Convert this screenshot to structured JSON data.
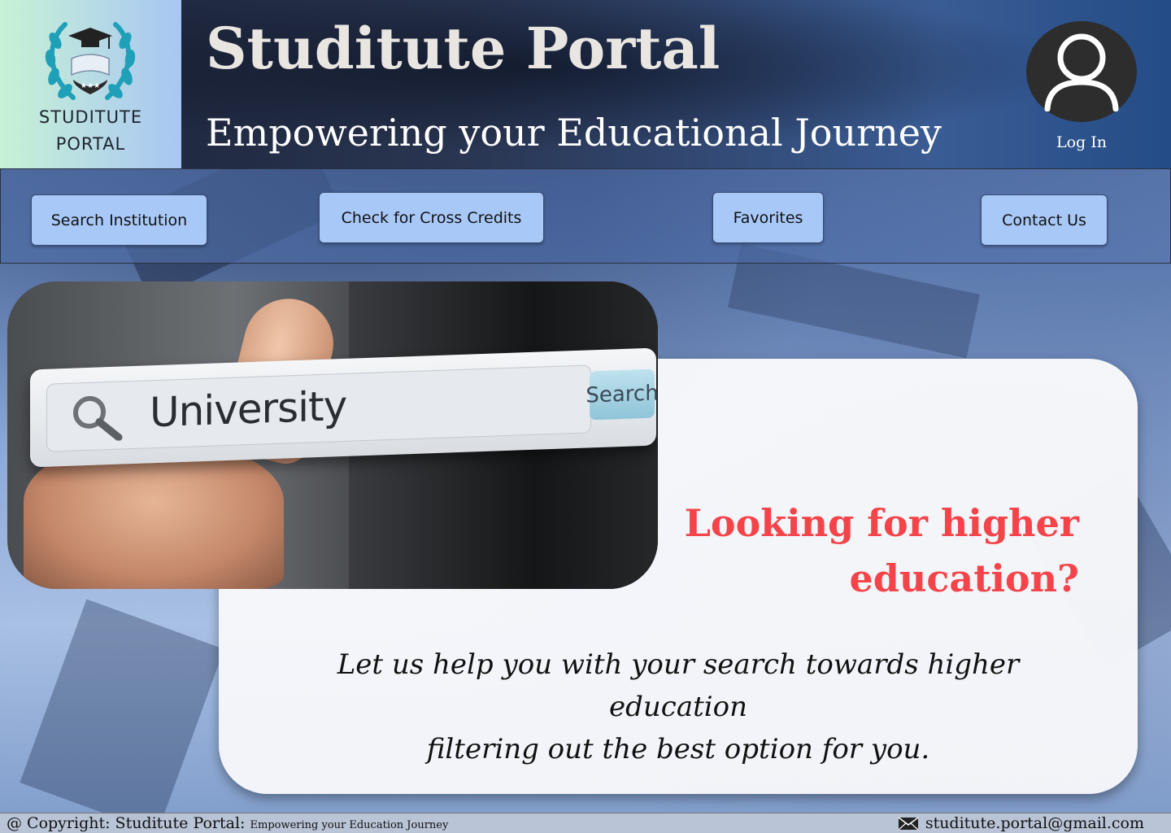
{
  "header": {
    "logo_line1": "STUDITUTE",
    "logo_line2": "PORTAL",
    "title": "Studitute Portal",
    "tagline": "Empowering your Educational Journey",
    "login_label": "Log In",
    "login_icon": "user-icon"
  },
  "nav": {
    "items": [
      {
        "label": "Search Institution"
      },
      {
        "label": "Check for Cross Credits"
      },
      {
        "label": "Favorites"
      },
      {
        "label": "Contact Us"
      }
    ]
  },
  "hero": {
    "image_query": "University",
    "image_search_button": "Search",
    "heading_line1": "Looking for higher",
    "heading_line2": "education?",
    "body_line1": "Let us help you with your search towards higher education",
    "body_line2": "filtering out the best option for you.",
    "heading_color": "#f4444a"
  },
  "footer": {
    "copyright_prefix": "@ Copyright: Studitute Portal:",
    "copyright_suffix": "Empowering your Education Journey",
    "email": "studitute.portal@gmail.com",
    "email_icon": "envelope-icon"
  }
}
